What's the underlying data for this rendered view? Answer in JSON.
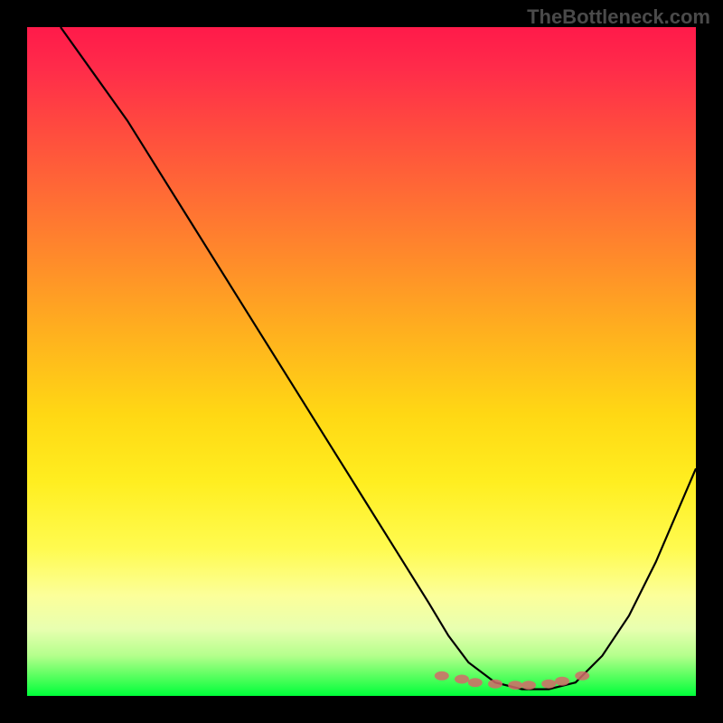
{
  "watermark": "TheBottleneck.com",
  "chart_data": {
    "type": "line",
    "title": "",
    "xlabel": "",
    "ylabel": "",
    "xlim": [
      0,
      100
    ],
    "ylim": [
      0,
      100
    ],
    "background_gradient": {
      "direction": "vertical",
      "stops": [
        {
          "pos": 0,
          "color": "#ff1a4a"
        },
        {
          "pos": 15,
          "color": "#ff4a3f"
        },
        {
          "pos": 35,
          "color": "#ff8c2a"
        },
        {
          "pos": 58,
          "color": "#ffd814"
        },
        {
          "pos": 78,
          "color": "#fffb50"
        },
        {
          "pos": 94,
          "color": "#b4ff8c"
        },
        {
          "pos": 100,
          "color": "#00ff3a"
        }
      ]
    },
    "series": [
      {
        "name": "curve",
        "type": "line",
        "color": "#000000",
        "x": [
          5,
          10,
          15,
          20,
          25,
          30,
          35,
          40,
          45,
          50,
          55,
          60,
          63,
          66,
          70,
          74,
          78,
          82,
          86,
          90,
          94,
          100
        ],
        "y": [
          100,
          93,
          86,
          78,
          70,
          62,
          54,
          46,
          38,
          30,
          22,
          14,
          9,
          5,
          2,
          1,
          1,
          2,
          6,
          12,
          20,
          34
        ]
      },
      {
        "name": "low-region-dots",
        "type": "scatter",
        "color": "#d46a6a",
        "x": [
          62,
          65,
          67,
          70,
          73,
          75,
          78,
          80,
          83
        ],
        "y": [
          3,
          2.5,
          2,
          1.8,
          1.6,
          1.6,
          1.8,
          2.2,
          3
        ]
      }
    ],
    "annotations": []
  }
}
